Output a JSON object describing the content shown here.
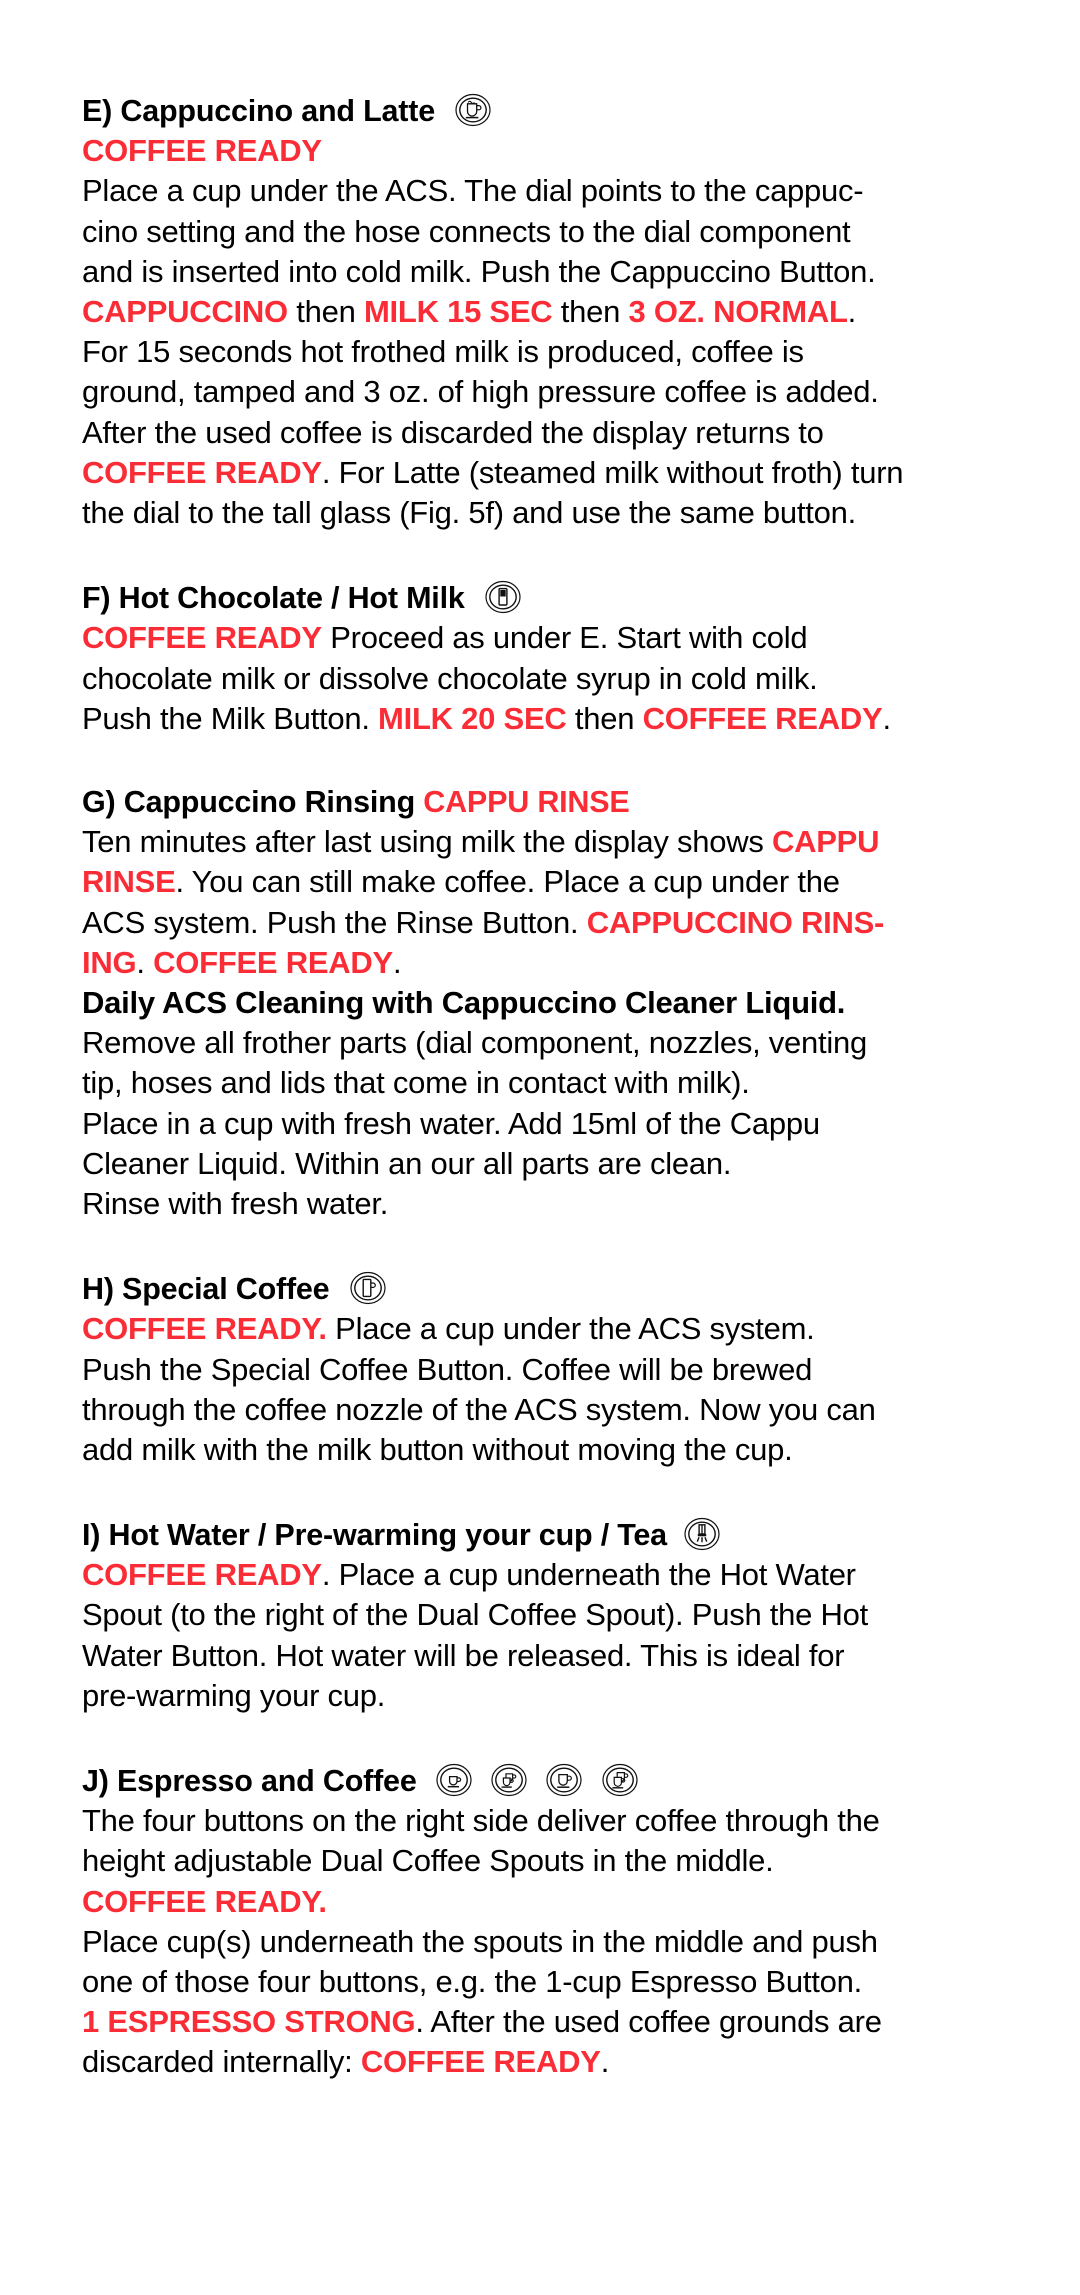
{
  "document": {
    "accent_red": "#fa2d37",
    "text_color": "#000000",
    "background": "#ffffff"
  },
  "sections": [
    {
      "id": "E",
      "heading": "E) Cappuccino and Latte",
      "icons": [
        "cappuccino-cup-icon"
      ],
      "status_line": "COFFEE READY",
      "body": [
        "Place a cup under the ACS. The dial points to the cappuc-",
        "cino setting and the hose connects to the dial component",
        "and is inserted into cold milk. Push the Cappuccino Button.",
        "CAPPUCCINO then MILK 15 SEC then 3 OZ. NORMAL.",
        "For 15 seconds hot frothed milk is produced, coffee is",
        "ground, tamped and 3 oz. of high pressure coffee is added.",
        "After the used coffee is discarded the display returns to",
        "COFFEE READY. For Latte (steamed milk without froth) turn",
        "the dial to the tall glass (Fig. 5f) and use the same button."
      ],
      "display_terms": [
        "COFFEE READY",
        "CAPPUCCINO",
        "MILK 15 SEC",
        "3 OZ. NORMAL"
      ],
      "line_parts": [
        [
          {
            "t": "Place a cup under the ACS. The dial points to the cappuc-",
            "red": false
          }
        ],
        [
          {
            "t": "cino setting and the hose connects to the dial component",
            "red": false
          }
        ],
        [
          {
            "t": "and is inserted into cold milk. Push the Cappuccino Button.",
            "red": false
          }
        ],
        [
          {
            "t": "CAPPUCCINO",
            "red": true
          },
          {
            "t": " then ",
            "red": false
          },
          {
            "t": "MILK 15 SEC",
            "red": true
          },
          {
            "t": " then ",
            "red": false
          },
          {
            "t": "3 OZ. NORMAL",
            "red": true
          },
          {
            "t": ".",
            "red": false
          }
        ],
        [
          {
            "t": "For 15 seconds hot frothed milk is produced, coffee is",
            "red": false
          }
        ],
        [
          {
            "t": "ground, tamped and 3 oz. of high pressure coffee is added.",
            "red": false
          }
        ],
        [
          {
            "t": "After the used coffee is discarded the display returns to",
            "red": false
          }
        ],
        [
          {
            "t": "COFFEE READY",
            "red": true
          },
          {
            "t": ". For Latte (steamed milk without froth) turn",
            "red": false
          }
        ],
        [
          {
            "t": "the dial to the tall glass (Fig. 5f) and use the same button.",
            "red": false
          }
        ]
      ]
    },
    {
      "id": "F",
      "heading": "F) Hot Chocolate / Hot Milk",
      "icons": [
        "milk-glass-icon"
      ],
      "line_parts": [
        [
          {
            "t": "COFFEE READY",
            "red": true
          },
          {
            "t": " Proceed as under E. Start with cold",
            "red": false
          }
        ],
        [
          {
            "t": "chocolate milk or dissolve chocolate syrup in cold milk.",
            "red": false
          }
        ],
        [
          {
            "t": "Push the Milk Button. ",
            "red": false
          },
          {
            "t": "MILK 20 SEC",
            "red": true
          },
          {
            "t": " then ",
            "red": false
          },
          {
            "t": "COFFEE READY",
            "red": true
          },
          {
            "t": ".",
            "red": false
          }
        ]
      ],
      "display_terms": [
        "COFFEE READY",
        "MILK 20 SEC"
      ]
    },
    {
      "id": "G",
      "heading_plain": "G) Cappuccino Rinsing ",
      "heading_red": "CAPPU RINSE",
      "icons": [],
      "line_parts": [
        [
          {
            "t": "Ten minutes after last using milk the display shows ",
            "red": false
          },
          {
            "t": "CAPPU",
            "red": true
          }
        ],
        [
          {
            "t": "RINSE",
            "red": true
          },
          {
            "t": ". You can still make coffee. Place a cup under the",
            "red": false
          }
        ],
        [
          {
            "t": "ACS system. Push the Rinse Button. ",
            "red": false
          },
          {
            "t": "CAPPUCCINO RINS-",
            "red": true
          }
        ],
        [
          {
            "t": "ING",
            "red": true
          },
          {
            "t": ". ",
            "red": false
          },
          {
            "t": "COFFEE READY",
            "red": true
          },
          {
            "t": ".",
            "red": false
          }
        ]
      ],
      "subheading": "Daily ACS Cleaning with Cappuccino Cleaner Liquid.",
      "sub_lines": [
        "Remove all frother parts (dial component, nozzles, venting",
        "tip, hoses and lids that come in contact with milk).",
        "Place in a cup with fresh water. Add 15ml of the Cappu",
        "Cleaner Liquid. Within an our all parts are clean.",
        "Rinse with fresh water."
      ],
      "display_terms": [
        "CAPPU RINSE",
        "CAPPUCCINO RINSING",
        "COFFEE READY"
      ]
    },
    {
      "id": "H",
      "heading": "H) Special Coffee",
      "icons": [
        "tall-mug-icon"
      ],
      "line_parts": [
        [
          {
            "t": "COFFEE READY.",
            "red": true
          },
          {
            "t": " Place a cup under the ACS system.",
            "red": false
          }
        ],
        [
          {
            "t": "Push the Special Coffee Button. Coffee will be brewed",
            "red": false
          }
        ],
        [
          {
            "t": "through the coffee nozzle of the ACS system. Now you can",
            "red": false
          }
        ],
        [
          {
            "t": "add milk with the milk button without moving the cup.",
            "red": false
          }
        ]
      ],
      "display_terms": [
        "COFFEE READY."
      ]
    },
    {
      "id": "I",
      "heading": "I) Hot Water / Pre-warming your cup / Tea",
      "icons": [
        "hot-water-spout-icon"
      ],
      "line_parts": [
        [
          {
            "t": "COFFEE READY",
            "red": true
          },
          {
            "t": ". Place a cup underneath the Hot Water",
            "red": false
          }
        ],
        [
          {
            "t": "Spout (to the right of the Dual Coffee Spout). Push the Hot",
            "red": false
          }
        ],
        [
          {
            "t": "Water Button. Hot water will be released. This is ideal for",
            "red": false
          }
        ],
        [
          {
            "t": "pre-warming your cup.",
            "red": false
          }
        ]
      ],
      "display_terms": [
        "COFFEE READY"
      ]
    },
    {
      "id": "J",
      "heading": "J) Espresso and Coffee",
      "icons": [
        "single-espresso-cup-icon",
        "double-espresso-cup-icon",
        "single-coffee-cup-icon",
        "double-coffee-cup-icon"
      ],
      "line_parts": [
        [
          {
            "t": "The four buttons on the right side deliver coffee through the",
            "red": false
          }
        ],
        [
          {
            "t": "height adjustable Dual Coffee Spouts in the middle.",
            "red": false
          }
        ],
        [
          {
            "t": "COFFEE READY.",
            "red": true
          }
        ],
        [
          {
            "t": "Place cup(s) underneath the spouts in the middle and push",
            "red": false
          }
        ],
        [
          {
            "t": "one of those four buttons, e.g. the 1-cup Espresso Button.",
            "red": false
          }
        ],
        [
          {
            "t": "1 ESPRESSO STRONG",
            "red": true
          },
          {
            "t": ". After the used coffee grounds are",
            "red": false
          }
        ],
        [
          {
            "t": "discarded internally: ",
            "red": false
          },
          {
            "t": "COFFEE READY",
            "red": true
          },
          {
            "t": ".",
            "red": false
          }
        ]
      ],
      "display_terms": [
        "COFFEE READY.",
        "1 ESPRESSO STRONG",
        "COFFEE READY"
      ]
    }
  ]
}
